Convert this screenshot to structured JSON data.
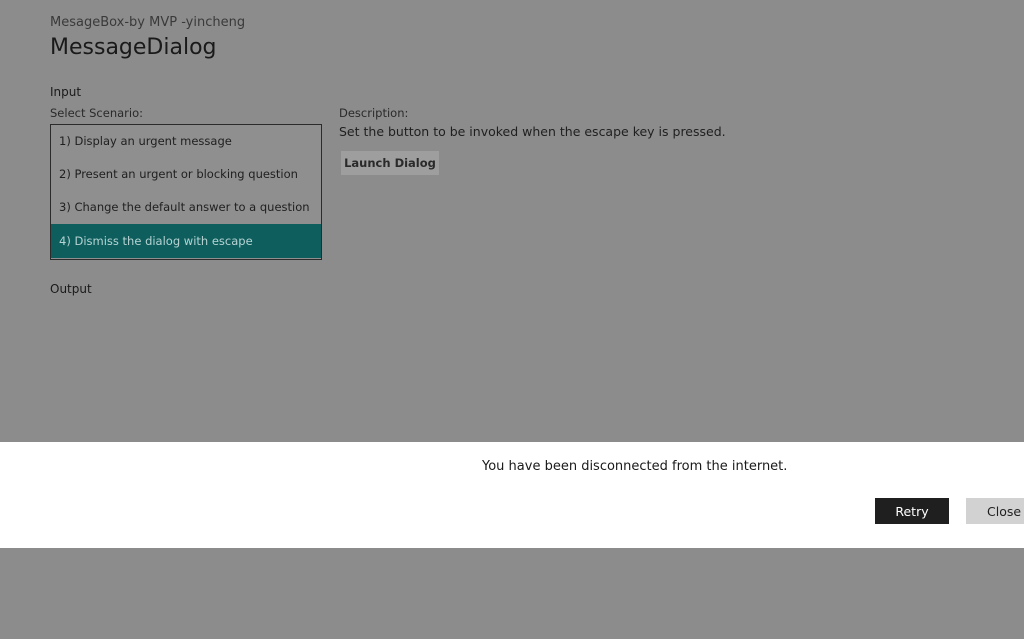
{
  "app": {
    "title": "MesageBox-by MVP -yincheng",
    "page_title": "MessageDialog"
  },
  "input": {
    "section_label": "Input",
    "select_label": "Select Scenario:",
    "scenarios": [
      {
        "label": "1) Display an urgent message",
        "selected": false
      },
      {
        "label": "2) Present an urgent or blocking question",
        "selected": false
      },
      {
        "label": "3) Change the default answer to a question",
        "selected": false
      },
      {
        "label": "4) Dismiss the dialog with escape",
        "selected": true
      }
    ],
    "description_label": "Description:",
    "description_text": "Set the button to be invoked when the escape key is pressed.",
    "launch_label": "Launch Dialog"
  },
  "output": {
    "section_label": "Output"
  },
  "dialog": {
    "message": "You have been disconnected from the internet.",
    "retry_label": "Retry",
    "close_label": "Close"
  },
  "colors": {
    "overlay_background": "#8c8c8c",
    "selected_item": "#0e5e5e",
    "dialog_background": "#ffffff",
    "primary_button": "#1f1f1f",
    "secondary_button": "#d2d2d2"
  }
}
